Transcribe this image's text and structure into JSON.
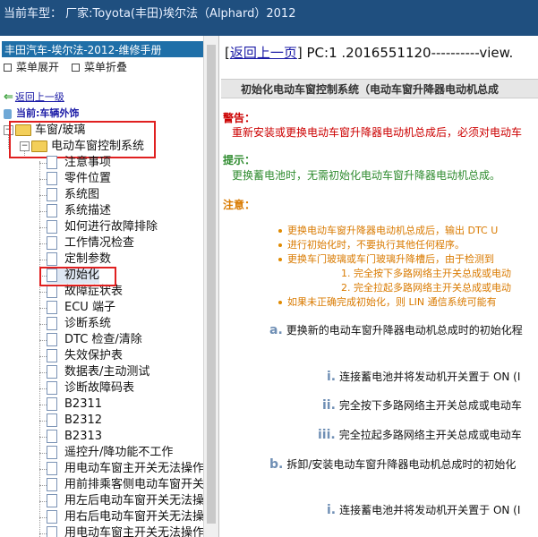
{
  "window": {
    "title": "当前车型：  厂家:Toyota(丰田)埃尔法（Alphard）2012"
  },
  "sidebar": {
    "header": "丰田汽车-埃尔法-2012-维修手册",
    "expand_all": "菜单展开",
    "collapse_all": "菜单折叠",
    "back": "返回上一级",
    "current": "当前:车辆外饰",
    "folders": [
      "车窗/玻璃",
      "电动车窗控制系统"
    ],
    "items": [
      "注意事项",
      "零件位置",
      "系统图",
      "系统描述",
      "如何进行故障排除",
      "工作情况检查",
      "定制参数",
      "初始化",
      "故障症状表",
      "ECU 端子",
      "诊断系统",
      "DTC 检查/清除",
      "失效保护表",
      "数据表/主动测试",
      "诊断故障码表",
      "B2311",
      "B2312",
      "B2313",
      "遥控升/降功能不工作",
      "用电动车窗主开关无法操作",
      "用前排乘客侧电动车窗开关",
      "用左后电动车窗开关无法操",
      "用右后电动车窗开关无法操",
      "用电动车窗主开关无法操作"
    ]
  },
  "content": {
    "back_link": "返回上一页",
    "page_code": "PC:1 .2016551120----------view.",
    "banner": "初始化电动车窗控制系统（电动车窗升降器电动机总成",
    "warning_label": "警告：",
    "warning_text": "重新安装或更换电动车窗升降器电动机总成后，必须对电动车",
    "hint_label": "提示：",
    "hint_text": "更换蓄电池时，无需初始化电动车窗升降器电动机总成。",
    "note_label": "注意：",
    "bullets": [
      "更换电动车窗升降器电动机总成后，输出 DTC U",
      "进行初始化时，不要执行其他任何程序。",
      "更换车门玻璃或车门玻璃升降槽后，由于检测到"
    ],
    "subitems": [
      "1. 完全按下多路网络主开关总成或电动",
      "2. 完全拉起多路网络主开关总成或电动"
    ],
    "bullet_last": "如果未正确完成初始化，则 LIN 通信系统可能有",
    "steps": [
      {
        "num": "a.",
        "text": "更换新的电动车窗升降器电动机总成时的初始化程"
      },
      {
        "num": "i.",
        "text": "连接蓄电池并将发动机开关置于 ON (I"
      },
      {
        "num": "ii.",
        "text": "完全按下多路网络主开关总成或电动车"
      },
      {
        "num": "iii.",
        "text": "完全拉起多路网络主开关总成或电动车"
      },
      {
        "num": "b.",
        "text": "拆卸/安装电动车窗升降器电动机总成时的初始化"
      },
      {
        "num": "i.",
        "text": "连接蓄电池并将发动机开关置于 ON (I"
      }
    ],
    "colors": {
      "warning": "#cc0000",
      "hint": "#2e8b2e",
      "note": "#d97a00"
    }
  }
}
